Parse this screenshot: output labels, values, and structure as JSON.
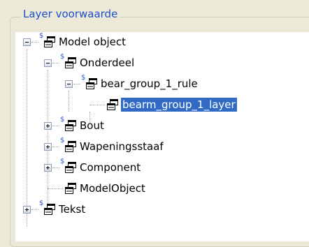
{
  "group": {
    "title": "Layer voorwaarde"
  },
  "tree": {
    "nodes": [
      {
        "label": "Model object",
        "expanded": true,
        "condition_marker": "$"
      },
      {
        "label": "Onderdeel",
        "expanded": true,
        "condition_marker": "$"
      },
      {
        "label": "bear_group_1_rule",
        "expanded": true,
        "condition_marker": "$"
      },
      {
        "label": "bearm_group_1_layer",
        "selected": true
      },
      {
        "label": "Bout",
        "expanded": false,
        "condition_marker": "$"
      },
      {
        "label": "Wapeningsstaaf",
        "expanded": false,
        "condition_marker": "$"
      },
      {
        "label": "Component",
        "expanded": false,
        "condition_marker": "$"
      },
      {
        "label": "ModelObject"
      },
      {
        "label": "Tekst",
        "expanded": false,
        "condition_marker": "$"
      }
    ]
  },
  "colors": {
    "selection": "#316ac5",
    "group_title": "#1a4fc8"
  },
  "icons": {
    "node": "object-tree-node-icon",
    "expand": "plus-box-icon",
    "collapse": "minus-box-icon"
  }
}
